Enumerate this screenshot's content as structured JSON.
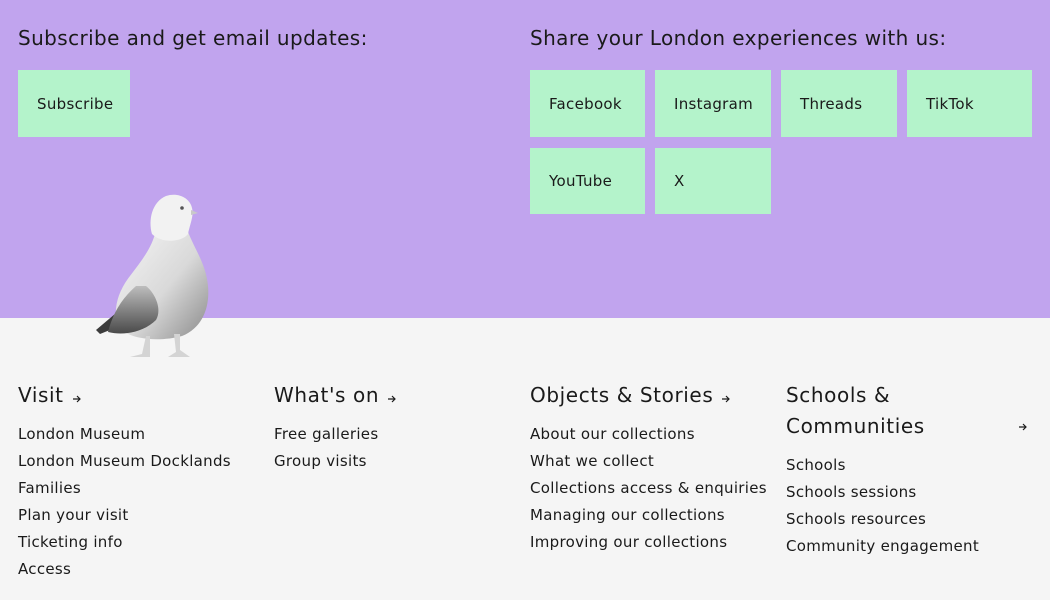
{
  "subscribe": {
    "heading": "Subscribe and get email updates:",
    "button_label": "Subscribe"
  },
  "social": {
    "heading": "Share your London experiences with us:",
    "buttons": [
      "Facebook",
      "Instagram",
      "Threads",
      "TikTok",
      "YouTube",
      "X"
    ]
  },
  "colors": {
    "top_background": "#c1a4ee",
    "tile_background": "#b4f3cb",
    "bottom_background": "#f5f5f5"
  },
  "footer": {
    "columns": [
      {
        "title": "Visit",
        "links": [
          "London Museum",
          "London Museum Docklands",
          "Families",
          "Plan your visit",
          "Ticketing info",
          "Access"
        ]
      },
      {
        "title": "What's on",
        "links": [
          "Free galleries",
          "Group visits"
        ]
      },
      {
        "title": "Objects & Stories",
        "links": [
          "About our collections",
          "What we collect",
          "Collections access & enquiries",
          "Managing our collections",
          "Improving our collections"
        ]
      },
      {
        "title_line1": "Schools &",
        "title_line2": "Communities",
        "links": [
          "Schools",
          "Schools sessions",
          "Schools resources",
          "Community engagement"
        ]
      }
    ]
  },
  "icons": {
    "column_arrow": "arrow-right-icon",
    "mascot": "pigeon-illustration"
  }
}
